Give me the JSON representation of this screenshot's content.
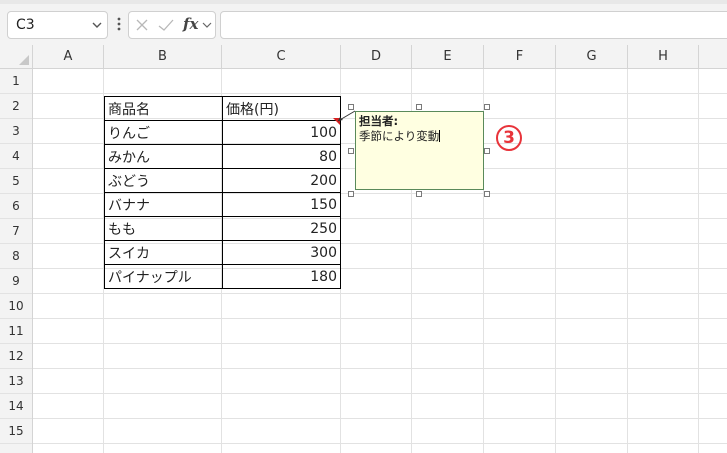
{
  "formula_bar": {
    "name_box": "C3",
    "fx_label": "fx",
    "formula_value": ""
  },
  "columns": [
    "A",
    "B",
    "C",
    "D",
    "E",
    "F",
    "G",
    "H"
  ],
  "rows": [
    "1",
    "2",
    "3",
    "4",
    "5",
    "6",
    "7",
    "8",
    "9",
    "10",
    "11",
    "12",
    "13",
    "14",
    "15"
  ],
  "table": {
    "headers": [
      "商品名",
      "価格(円)"
    ],
    "rows": [
      {
        "name": "りんご",
        "price": "100"
      },
      {
        "name": "みかん",
        "price": "80"
      },
      {
        "name": "ぶどう",
        "price": "200"
      },
      {
        "name": "バナナ",
        "price": "150"
      },
      {
        "name": "もも",
        "price": "250"
      },
      {
        "name": "スイカ",
        "price": "300"
      },
      {
        "name": "パイナップル",
        "price": "180"
      }
    ]
  },
  "comment": {
    "author": "担当者:",
    "text": "季節により変動"
  },
  "step_marker": "③",
  "colors": {
    "comment_background": "#ffffe1",
    "comment_indicator": "#d62020",
    "step_marker": "#e8333a"
  }
}
